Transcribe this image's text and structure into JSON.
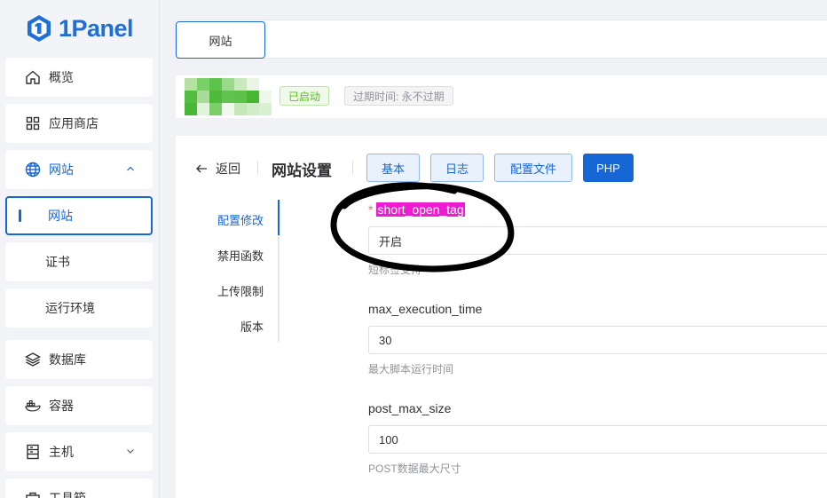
{
  "brand": {
    "name": "1Panel"
  },
  "sidebar": {
    "items": [
      {
        "label": "概览",
        "icon": "home-icon"
      },
      {
        "label": "应用商店",
        "icon": "grid-icon"
      },
      {
        "label": "网站",
        "icon": "globe-icon"
      },
      {
        "label": "网站"
      },
      {
        "label": "证书"
      },
      {
        "label": "运行环境"
      },
      {
        "label": "数据库",
        "icon": "layers-icon"
      },
      {
        "label": "容器",
        "icon": "docker-icon"
      },
      {
        "label": "主机",
        "icon": "server-icon"
      },
      {
        "label": "工具箱",
        "icon": "toolbox-icon"
      }
    ]
  },
  "tabs": [
    {
      "label": "网站"
    }
  ],
  "site": {
    "status": "已启动",
    "expiry": "过期时间: 永不过期"
  },
  "header": {
    "back_label": "返回",
    "title": "网站设置",
    "buttons": [
      "基本",
      "日志",
      "配置文件",
      "PHP"
    ]
  },
  "subnav": [
    "配置修改",
    "禁用函数",
    "上传限制",
    "版本"
  ],
  "fields": [
    {
      "label": "short_open_tag",
      "value": "开启",
      "hint": "短标签支持"
    },
    {
      "label": "max_execution_time",
      "value": "30",
      "hint": "最大脚本运行时间"
    },
    {
      "label": "post_max_size",
      "value": "100",
      "hint": "POST数据最大尺寸"
    }
  ],
  "colors": {
    "accent": "#1766d6",
    "success": "#52c41a",
    "highlight": "#ee1cd0",
    "required": "#f56c6c"
  }
}
